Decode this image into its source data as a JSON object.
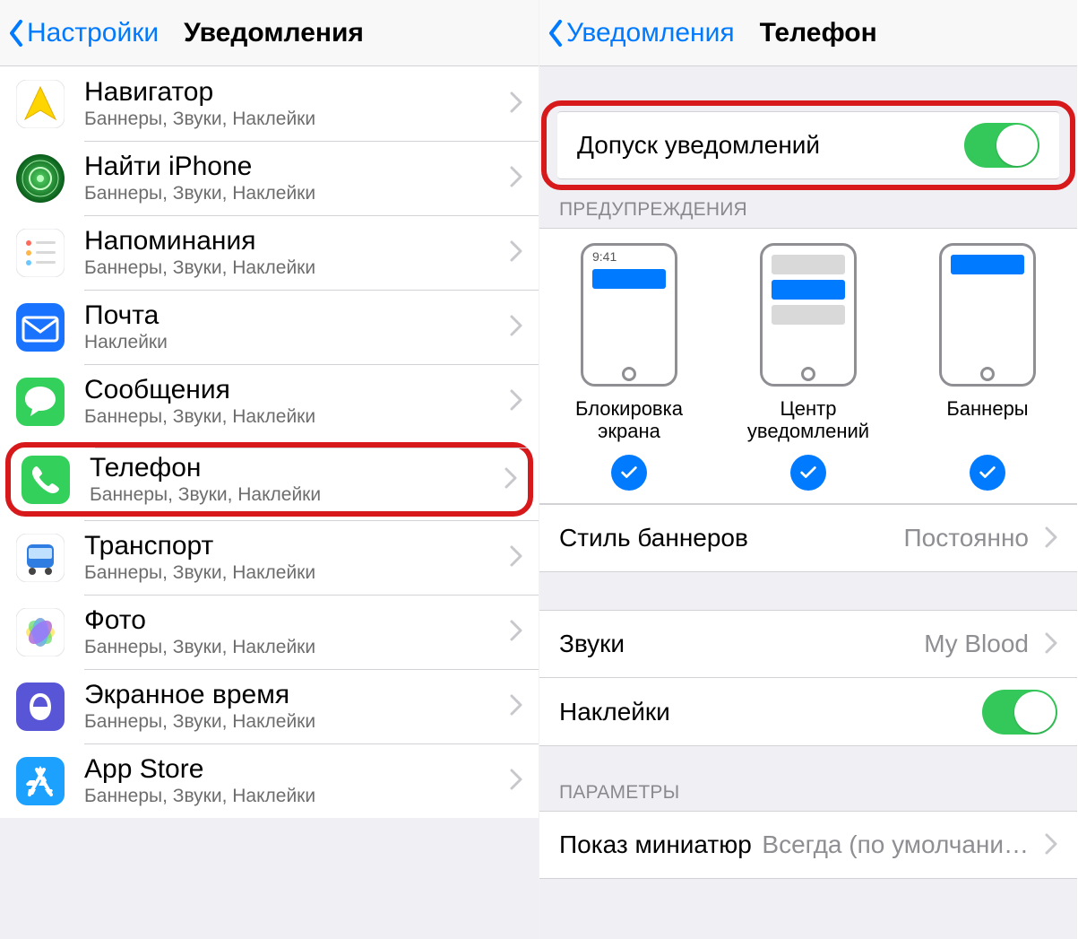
{
  "left": {
    "back": "Настройки",
    "title": "Уведомления",
    "apps": [
      {
        "name": "Навигатор",
        "sub": "Баннеры, Звуки, Наклейки",
        "icon": "navigator"
      },
      {
        "name": "Найти iPhone",
        "sub": "Баннеры, Звуки, Наклейки",
        "icon": "findiphone"
      },
      {
        "name": "Напоминания",
        "sub": "Баннеры, Звуки, Наклейки",
        "icon": "reminders"
      },
      {
        "name": "Почта",
        "sub": "Наклейки",
        "icon": "mail"
      },
      {
        "name": "Сообщения",
        "sub": "Баннеры, Звуки, Наклейки",
        "icon": "messages"
      },
      {
        "name": "Телефон",
        "sub": "Баннеры, Звуки, Наклейки",
        "icon": "phone",
        "highlight": true
      },
      {
        "name": "Транспорт",
        "sub": "Баннеры, Звуки, Наклейки",
        "icon": "transport"
      },
      {
        "name": "Фото",
        "sub": "Баннеры, Звуки, Наклейки",
        "icon": "photos"
      },
      {
        "name": "Экранное время",
        "sub": "Баннеры, Звуки, Наклейки",
        "icon": "screentime"
      },
      {
        "name": "App Store",
        "sub": "Баннеры, Звуки, Наклейки",
        "icon": "appstore"
      }
    ]
  },
  "right": {
    "back": "Уведомления",
    "title": "Телефон",
    "allow_label": "Допуск уведомлений",
    "allow_on": true,
    "alerts_header": "ПРЕДУПРЕЖДЕНИЯ",
    "preview": {
      "lock": "Блокировка экрана",
      "lock_time": "9:41",
      "center": "Центр уведомлений",
      "banner": "Баннеры"
    },
    "banner_style_label": "Стиль баннеров",
    "banner_style_value": "Постоянно",
    "sounds_label": "Звуки",
    "sounds_value": "My Blood",
    "badges_label": "Наклейки",
    "badges_on": true,
    "params_header": "ПАРАМЕТРЫ",
    "thumbs_label": "Показ миниатюр",
    "thumbs_value": "Всегда (по умолчани…"
  }
}
